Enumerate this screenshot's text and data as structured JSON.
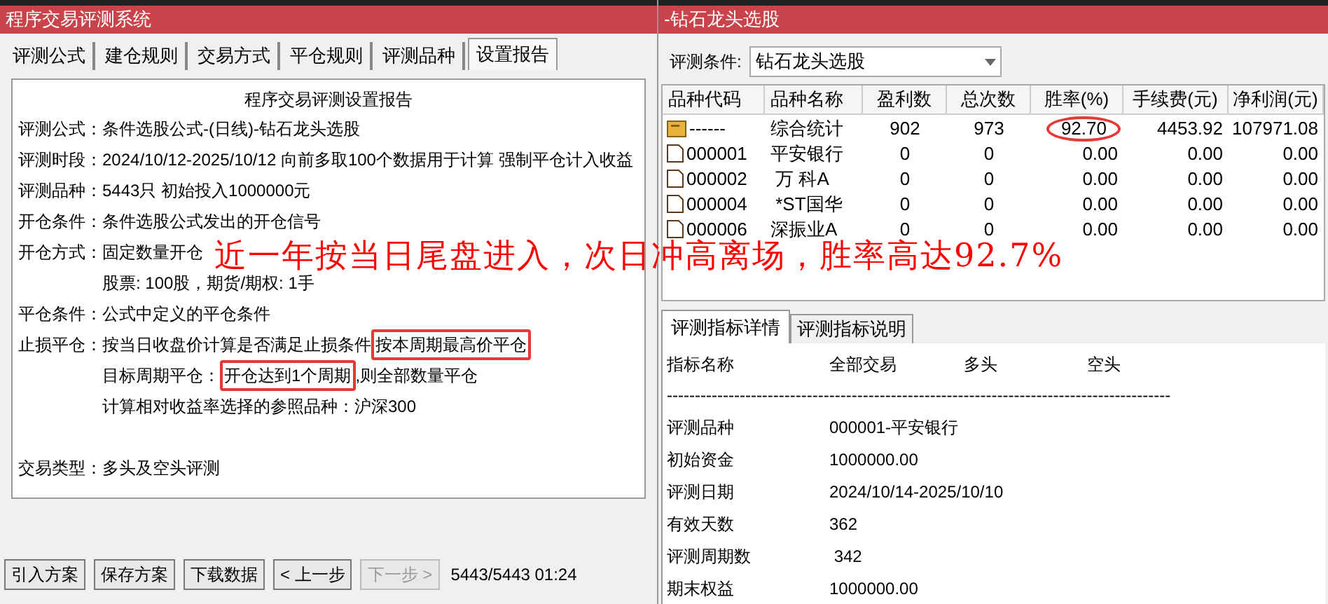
{
  "left_window": {
    "title": "程序交易评测系统",
    "tabs": [
      {
        "label": "评测公式",
        "selected": false
      },
      {
        "label": "建仓规则",
        "selected": false
      },
      {
        "label": "交易方式",
        "selected": false
      },
      {
        "label": "平仓规则",
        "selected": false
      },
      {
        "label": "评测品种",
        "selected": false
      },
      {
        "label": "设置报告",
        "selected": true
      }
    ],
    "report": {
      "heading": "程序交易评测设置报告",
      "lines": [
        {
          "label": "评测公式：",
          "parts": [
            {
              "text": "条件选股公式-(日线)-钻石龙头选股",
              "boxed": false
            }
          ]
        },
        {
          "label": "评测时段：",
          "parts": [
            {
              "text": "2024/10/12-2025/10/12 向前多取100个数据用于计算 强制平仓计入收益",
              "boxed": false
            }
          ]
        },
        {
          "label": "评测品种：",
          "parts": [
            {
              "text": "5443只 初始投入1000000元",
              "boxed": false
            }
          ]
        },
        {
          "label": "开仓条件：",
          "parts": [
            {
              "text": "条件选股公式发出的开仓信号",
              "boxed": false
            }
          ]
        },
        {
          "label": "开仓方式：",
          "parts": [
            {
              "text": "固定数量开仓",
              "boxed": false
            }
          ]
        },
        {
          "parts": [
            {
              "text": "股票: 100股，期货/期权: 1手",
              "boxed": false
            }
          ]
        },
        {
          "label": "平仓条件：",
          "parts": [
            {
              "text": "公式中定义的平仓条件",
              "boxed": false
            }
          ]
        },
        {
          "label": "止损平仓：",
          "parts": [
            {
              "text": "按当日收盘价计算是否满足止损条件",
              "boxed": false
            },
            {
              "text": "按本周期最高价平仓",
              "boxed": true
            }
          ]
        },
        {
          "parts": [
            {
              "text": "目标周期平仓：",
              "boxed": false
            },
            {
              "text": "开仓达到1个周期",
              "boxed": true
            },
            {
              "text": ",则全部数量平仓",
              "boxed": false
            }
          ]
        },
        {
          "parts": [
            {
              "text": "计算相对收益率选择的参照品种：沪深300",
              "boxed": false
            }
          ]
        },
        {
          "gap": true,
          "label": "交易类型：",
          "parts": [
            {
              "text": "多头及空头评测",
              "boxed": false
            }
          ]
        }
      ]
    },
    "buttons": [
      {
        "label": "引入方案",
        "disabled": false
      },
      {
        "label": "保存方案",
        "disabled": false
      },
      {
        "label": "下载数据",
        "disabled": false
      },
      {
        "label": "< 上一步",
        "disabled": false
      },
      {
        "label": "下一步 >",
        "disabled": true
      }
    ],
    "status": "5443/5443 01:24"
  },
  "right_window": {
    "title": "-钻石龙头选股",
    "condition": {
      "label": "评测条件:",
      "value": "钻石龙头选股"
    },
    "table": {
      "columns": [
        "品种代码",
        "品种名称",
        "盈利数",
        "总次数",
        "胜率(%)",
        "手续费(元)",
        "净利润(元)"
      ],
      "rows": [
        {
          "kind": "summary",
          "cells": [
            "------",
            "综合统计",
            "902",
            "973",
            "92.70",
            "4453.92",
            "107971.08"
          ],
          "circled": true
        },
        {
          "kind": "stock",
          "cells": [
            "000001",
            "平安银行",
            "0",
            "0",
            "0.00",
            "0.00",
            "0.00"
          ],
          "circled": false
        },
        {
          "kind": "stock",
          "cells": [
            "000002",
            " 万 科A",
            "0",
            "0",
            "0.00",
            "0.00",
            "0.00"
          ],
          "circled": false
        },
        {
          "kind": "stock",
          "cells": [
            "000004",
            " *ST国华",
            "0",
            "0",
            "0.00",
            "0.00",
            "0.00"
          ],
          "circled": false
        },
        {
          "kind": "stock",
          "cells": [
            "000006",
            "深振业A",
            "0",
            "0",
            "0.00",
            "0.00",
            "0.00"
          ],
          "circled": false
        }
      ]
    },
    "tabs": [
      {
        "label": "评测指标详情",
        "selected": true
      },
      {
        "label": "评测指标说明",
        "selected": false
      }
    ],
    "details": {
      "columns": [
        "指标名称",
        "全部交易",
        "多头",
        "空头"
      ],
      "divider": "------------------------------------------------------------------------------------------",
      "rows": [
        {
          "name": "评测品种",
          "value": "000001-平安银行"
        },
        {
          "name": "初始资金",
          "value": "1000000.00"
        },
        {
          "name": "评测日期",
          "value": "2024/10/14-2025/10/10"
        },
        {
          "name": "有效天数",
          "value": "362"
        },
        {
          "name": "评测周期数",
          "value": " 342"
        },
        {
          "name": "期末权益",
          "value": "1000000.00"
        }
      ]
    }
  },
  "overlay_caption": "近一年按当日尾盘进入，次日冲高离场，胜率高达92.7%"
}
